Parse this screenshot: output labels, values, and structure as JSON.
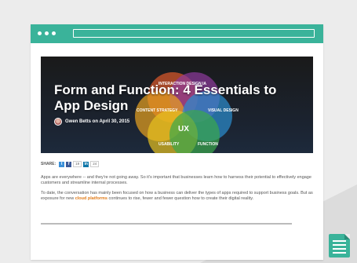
{
  "window": {
    "url": ""
  },
  "hero": {
    "title": "Form and Function: 4 Essentials to App Design",
    "author_line": "Gwen Betts on April 30, 2015",
    "venn": {
      "center": "UX",
      "labels": [
        "INTERACTION DESIGN",
        "IA",
        "CONTENT STRATEGY",
        "VISUAL DESIGN",
        "USABILITY",
        "FUNCTION"
      ],
      "colors": [
        "#e05a2b",
        "#8e3a9c",
        "#e8a31f",
        "#2b8fd0",
        "#e8c21f",
        "#3aa84b"
      ]
    }
  },
  "share": {
    "label": "SHARE:",
    "twitter_icon": "twitter-icon",
    "facebook_icon": "facebook-icon",
    "facebook_count": "19",
    "linkedin_icon": "linkedin-icon",
    "linkedin_count": "24"
  },
  "article": {
    "p1": "Apps are everywhere -- and they're not going away. So it's important that businesses learn how to harness their potential to effectively engage customers and streamline internal processes.",
    "p2_before": "To date, the conversation has mainly been focused on how a business can deliver the types of apps required to support business goals. But as exposure for new ",
    "p2_link": "cloud platforms",
    "p2_after": " continues to rise, fewer and fewer question how to create their digital reality."
  }
}
